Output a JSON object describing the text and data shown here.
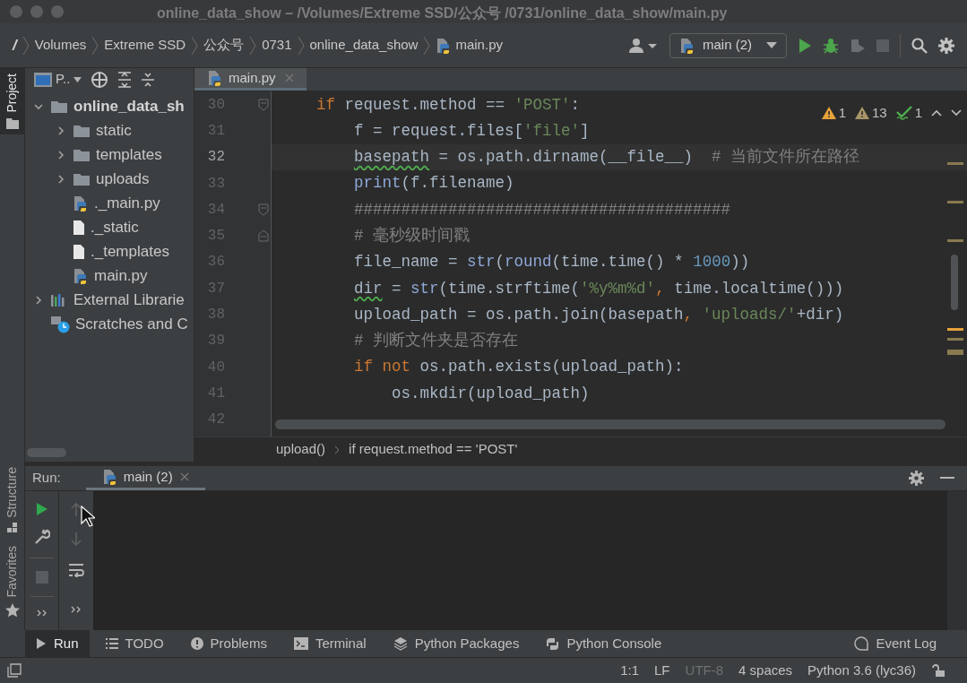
{
  "window": {
    "title": "online_data_show – /Volumes/Extreme SSD/公众号 /0731/online_data_show/main.py"
  },
  "breadcrumbs": [
    {
      "label": "/",
      "kind": "root"
    },
    {
      "label": "Volumes",
      "kind": "folder"
    },
    {
      "label": "Extreme SSD",
      "kind": "folder"
    },
    {
      "label": "公众号",
      "kind": "folder"
    },
    {
      "label": "0731",
      "kind": "folder"
    },
    {
      "label": "online_data_show",
      "kind": "folder"
    },
    {
      "label": "main.py",
      "kind": "python"
    }
  ],
  "run_config": {
    "label": "main (2)"
  },
  "side_tabs_top": [
    {
      "label": "Project",
      "selected": true
    }
  ],
  "side_tabs_bottom": [
    {
      "label": "Structure",
      "kind": "structure"
    },
    {
      "label": "Favorites",
      "kind": "favorites"
    }
  ],
  "project_panel": {
    "label": "P..",
    "tree": [
      {
        "label": "online_data_sh",
        "kind": "folder",
        "expanded": true,
        "bold": true,
        "children": [
          {
            "label": "static",
            "kind": "folder",
            "expanded": false
          },
          {
            "label": "templates",
            "kind": "folder",
            "expanded": false
          },
          {
            "label": "uploads",
            "kind": "folder",
            "expanded": false
          },
          {
            "label": "._main.py",
            "kind": "python"
          },
          {
            "label": "._static",
            "kind": "file"
          },
          {
            "label": "._templates",
            "kind": "file"
          },
          {
            "label": "main.py",
            "kind": "python"
          }
        ]
      },
      {
        "label": "External Librarie",
        "kind": "library",
        "expanded": false
      },
      {
        "label": "Scratches and C",
        "kind": "scratches"
      }
    ]
  },
  "editor_tabs": [
    {
      "label": "main.py",
      "selected": true
    }
  ],
  "inspections": [
    {
      "kind": "warning",
      "count": "1"
    },
    {
      "kind": "weak_warning",
      "count": "13"
    },
    {
      "kind": "typo",
      "count": "1"
    }
  ],
  "code_lines": [
    {
      "number": "30",
      "current": false,
      "kind": "fold_start",
      "tokens": [
        {
          "text": "    if",
          "kind": "keyword"
        },
        {
          "text": " request.method == ",
          "kind": "plain"
        },
        {
          "text": "'POST'",
          "kind": "string"
        },
        {
          "text": ":",
          "kind": "plain"
        }
      ]
    },
    {
      "number": "31",
      "current": false,
      "kind": "plain",
      "tokens": [
        {
          "text": "        f = request.files[",
          "kind": "plain"
        },
        {
          "text": "'file'",
          "kind": "string"
        },
        {
          "text": "]",
          "kind": "plain"
        }
      ]
    },
    {
      "number": "32",
      "current": true,
      "kind": "plain",
      "tokens": [
        {
          "text": "        basepath",
          "kind": "plain",
          "squiggle": true
        },
        {
          "text": " = os.path.dirname(__file__)  ",
          "kind": "plain"
        },
        {
          "text": "# 当前文件所在路径",
          "kind": "comment"
        }
      ]
    },
    {
      "number": "33",
      "current": false,
      "kind": "plain",
      "tokens": [
        {
          "text": "        print",
          "kind": "builtin"
        },
        {
          "text": "(f.filename)",
          "kind": "plain"
        }
      ]
    },
    {
      "number": "34",
      "current": false,
      "kind": "fold_start",
      "tokens": [
        {
          "text": "        ########################################",
          "kind": "comment"
        }
      ]
    },
    {
      "number": "35",
      "current": false,
      "kind": "fold_end",
      "tokens": [
        {
          "text": "        # 毫秒级时间戳",
          "kind": "comment"
        }
      ]
    },
    {
      "number": "36",
      "current": false,
      "kind": "plain",
      "tokens": [
        {
          "text": "        file_name = ",
          "kind": "plain"
        },
        {
          "text": "str",
          "kind": "builtin"
        },
        {
          "text": "(",
          "kind": "plain"
        },
        {
          "text": "round",
          "kind": "builtin"
        },
        {
          "text": "(time.time() * ",
          "kind": "plain"
        },
        {
          "text": "1000",
          "kind": "number"
        },
        {
          "text": "))",
          "kind": "plain"
        }
      ]
    },
    {
      "number": "37",
      "current": false,
      "kind": "plain",
      "tokens": [
        {
          "text": "        dir",
          "kind": "plain",
          "squiggle": true
        },
        {
          "text": " = ",
          "kind": "plain"
        },
        {
          "text": "str",
          "kind": "builtin"
        },
        {
          "text": "(time.strftime(",
          "kind": "plain"
        },
        {
          "text": "'%y%m%d'",
          "kind": "string"
        },
        {
          "text": ",",
          "kind": "keyword"
        },
        {
          "text": " time.localtime()))",
          "kind": "plain"
        }
      ]
    },
    {
      "number": "38",
      "current": false,
      "kind": "plain",
      "tokens": [
        {
          "text": "        upload_path = os.path.join(basepath",
          "kind": "plain"
        },
        {
          "text": ",",
          "kind": "keyword"
        },
        {
          "text": " 'uploads/'",
          "kind": "string"
        },
        {
          "text": "+dir)",
          "kind": "plain"
        }
      ]
    },
    {
      "number": "39",
      "current": false,
      "kind": "plain",
      "tokens": [
        {
          "text": "        # 判断文件夹是否存在",
          "kind": "comment"
        }
      ]
    },
    {
      "number": "40",
      "current": false,
      "kind": "plain",
      "tokens": [
        {
          "text": "        if not",
          "kind": "keyword"
        },
        {
          "text": " os.path.exists(upload_path):",
          "kind": "plain"
        }
      ]
    },
    {
      "number": "41",
      "current": false,
      "kind": "plain",
      "tokens": [
        {
          "text": "            os.mkdir(upload_path)",
          "kind": "plain"
        }
      ]
    },
    {
      "number": "42",
      "current": false,
      "kind": "plain"
    }
  ],
  "code_breadcrumbs": [
    "upload()",
    "if request.method == 'POST'"
  ],
  "run_panel": {
    "label": "Run:",
    "tabs": [
      {
        "label": "main (2)",
        "selected": true
      }
    ]
  },
  "tool_tabs": [
    {
      "label": "Run",
      "kind": "run",
      "selected": true
    },
    {
      "label": "TODO",
      "kind": "todo",
      "selected": false
    },
    {
      "label": "Problems",
      "kind": "problems",
      "selected": false
    },
    {
      "label": "Terminal",
      "kind": "terminal",
      "selected": false
    },
    {
      "label": "Python Packages",
      "kind": "packages",
      "selected": false
    },
    {
      "label": "Python Console",
      "kind": "console",
      "selected": false
    }
  ],
  "event_log": {
    "label": "Event Log"
  },
  "status_bar": [
    {
      "text": "1:1",
      "disabled": false
    },
    {
      "text": "LF",
      "disabled": false
    },
    {
      "text": "UTF-8",
      "disabled": true
    },
    {
      "text": "4 spaces",
      "disabled": false
    },
    {
      "text": "Python 3.6 (lyc36)",
      "disabled": false
    }
  ]
}
